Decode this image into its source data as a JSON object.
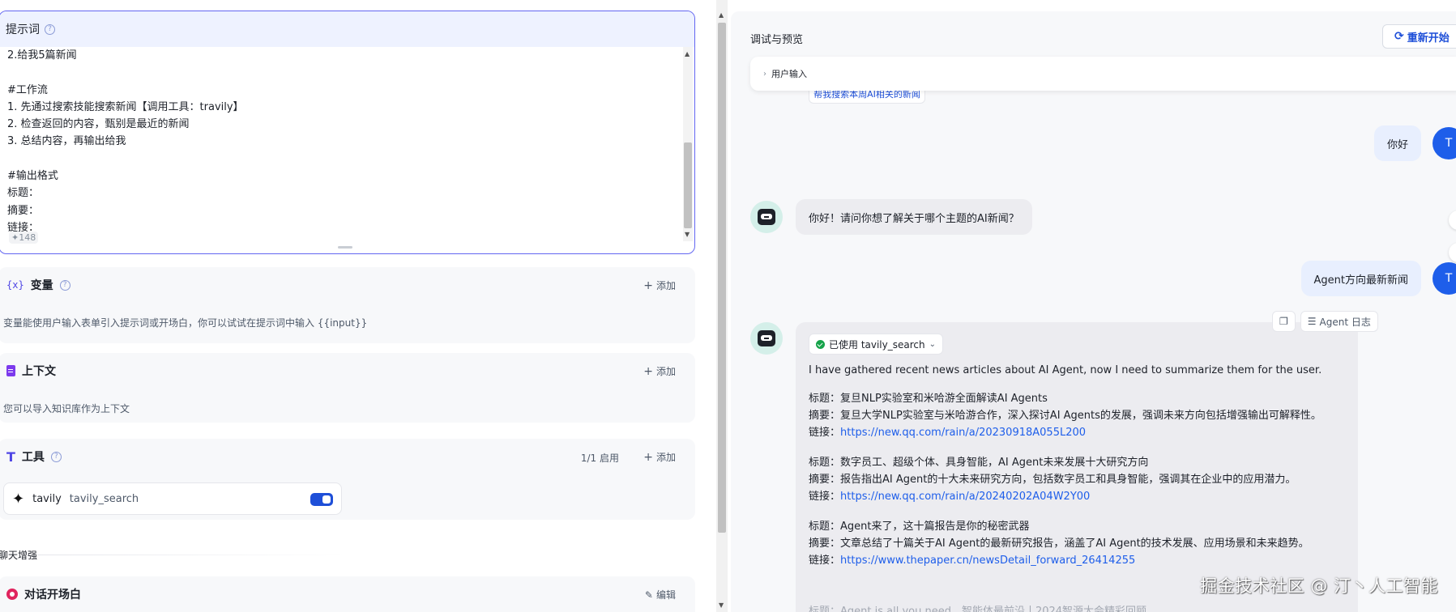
{
  "prompt": {
    "title": "提示词",
    "lines": [
      "2.给我5篇新闻",
      "",
      "#工作流",
      "1. 先通过搜索技能搜索新闻【调用工具：travily】",
      "2. 检查返回的内容，甄别是最近的新闻",
      "3. 总结内容，再输出给我",
      "",
      "#输出格式",
      "标题：",
      "摘要：",
      "链接："
    ],
    "char_count": "148"
  },
  "variables": {
    "icon": "{x}",
    "title": "变量",
    "add_label": "添加",
    "description": "变量能使用户输入表单引入提示词或开场白，你可以试试在提示词中输入 {{input}}"
  },
  "context": {
    "title": "上下文",
    "add_label": "添加",
    "description": "您可以导入知识库作为上下文"
  },
  "tools": {
    "title": "工具",
    "enabled_count": "1/1 启用",
    "add_label": "添加",
    "items": [
      {
        "name": "tavily",
        "function": "tavily_search",
        "enabled": true
      }
    ]
  },
  "enhance_label": "聊天增强",
  "opening": {
    "title": "对话开场白",
    "edit_label": "编辑"
  },
  "preview": {
    "title": "调试与预览",
    "restart_label": "重新开始",
    "user_input_label": "用户输入",
    "suggestion": "帮我搜索本周AI相关的新闻",
    "messages": [
      {
        "role": "user",
        "avatar": "T",
        "text": "你好"
      },
      {
        "role": "bot",
        "text": "你好！请问你想了解关于哪个主题的AI新闻？"
      },
      {
        "role": "user",
        "avatar": "T",
        "text": "Agent方向最新新闻"
      }
    ],
    "actions": {
      "log_label": "Agent 日志"
    },
    "reply": {
      "tool_used": "已使用 tavily_search",
      "intro": "I have gathered recent news articles about AI Agent, now I need to summarize them for the user.",
      "news": [
        {
          "title": "标题：复旦NLP实验室和米哈游全面解读AI Agents",
          "summary": "摘要：复旦大学NLP实验室与米哈游合作，深入探讨AI Agents的发展，强调未来方向包括增强输出可解释性。",
          "link_label": "链接：",
          "link": "https://new.qq.com/rain/a/20230918A055L200"
        },
        {
          "title": "标题：数字员工、超级个体、具身智能，AI Agent未来发展十大研究方向",
          "summary": "摘要：报告指出AI Agent的十大未来研究方向，包括数字员工和具身智能，强调其在企业中的应用潜力。",
          "link_label": "链接：",
          "link": "https://new.qq.com/rain/a/20240202A04W2Y00"
        },
        {
          "title": "标题：Agent来了，这十篇报告是你的秘密武器",
          "summary": "摘要：文章总结了十篇关于AI Agent的最新研究报告，涵盖了AI Agent的技术发展、应用场景和未来趋势。",
          "link_label": "链接：",
          "link": "https://www.thepaper.cn/newsDetail_forward_26414255"
        }
      ],
      "faded": "标题：Agent is all you need，智能体最前沿丨2024智源大会精彩回顾"
    }
  },
  "watermark": "掘金技术社区 @ 汀丶人工智能",
  "colors": {
    "accent": "#6366f1",
    "primary_blue": "#1e4fd8",
    "link_blue": "#1e5eea",
    "success_green": "#16a34a"
  }
}
